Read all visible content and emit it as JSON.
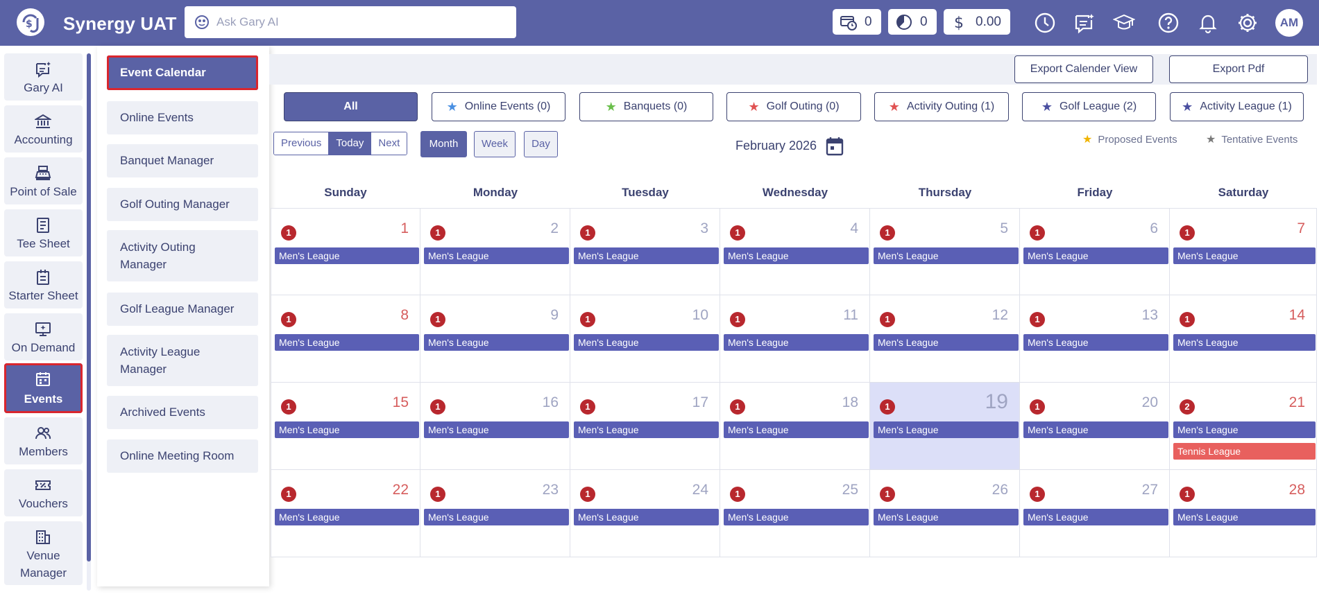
{
  "header": {
    "title": "Synergy UAT",
    "logo_icon": "dollar-logo-icon",
    "search_placeholder": "Ask Gary AI",
    "counters": [
      {
        "icon": "card-clock-icon",
        "value": "0"
      },
      {
        "icon": "pie-chart-icon",
        "value": "0"
      },
      {
        "icon": "dollar-icon",
        "value": "0.00"
      }
    ],
    "icons": [
      "clock-icon",
      "chat-bubble-icon",
      "graduation-icon",
      "help-icon",
      "bell-icon",
      "gear-icon"
    ],
    "avatar": "AM"
  },
  "sidebar": {
    "items": [
      {
        "label": "Gary AI",
        "icon": "gary-ai-icon"
      },
      {
        "label": "Accounting",
        "icon": "bank-icon"
      },
      {
        "label": "Point of Sale",
        "icon": "cash-register-icon"
      },
      {
        "label": "Tee Sheet",
        "icon": "document-icon"
      },
      {
        "label": "Starter Sheet",
        "icon": "clipboard-icon"
      },
      {
        "label": "On Demand",
        "icon": "monitor-icon"
      },
      {
        "label": "Events",
        "icon": "calendar-icon",
        "active": true
      },
      {
        "label": "Members",
        "icon": "users-icon"
      },
      {
        "label": "Vouchers",
        "icon": "ticket-icon"
      },
      {
        "label": "Venue Manager",
        "icon": "building-icon"
      }
    ]
  },
  "submenu": {
    "items": [
      {
        "label": "Event Calendar",
        "active": true
      },
      {
        "label": "Online Events"
      },
      {
        "label": "Banquet Manager"
      },
      {
        "label": "Golf Outing Manager"
      },
      {
        "label": "Activity Outing Manager"
      },
      {
        "label": "Golf League Manager"
      },
      {
        "label": "Activity League Manager"
      },
      {
        "label": "Archived Events"
      },
      {
        "label": "Online Meeting Room"
      }
    ]
  },
  "toolbar": {
    "export_calendar": "Export Calender View",
    "export_pdf": "Export Pdf"
  },
  "filters": [
    {
      "label": "All",
      "star_color": null,
      "active": true
    },
    {
      "label": "Online Events (0)",
      "star_color": "#4a90e2"
    },
    {
      "label": "Banquets (0)",
      "star_color": "#6abf4b"
    },
    {
      "label": "Golf Outing (0)",
      "star_color": "#e05252"
    },
    {
      "label": "Activity Outing (1)",
      "star_color": "#e05252"
    },
    {
      "label": "Golf League (2)",
      "star_color": "#4a4fa0"
    },
    {
      "label": "Activity League (1)",
      "star_color": "#4a4fa0"
    }
  ],
  "calendar_nav": {
    "previous": "Previous",
    "today": "Today",
    "next": "Next",
    "views": [
      "Month",
      "Week",
      "Day"
    ],
    "active_view": "Month",
    "month_label": "February 2026"
  },
  "legend": [
    {
      "label": "Proposed Events",
      "star_color": "#f0b400"
    },
    {
      "label": "Tentative Events",
      "star_color": "#7a7a7a"
    }
  ],
  "calendar": {
    "day_names": [
      "Sunday",
      "Monday",
      "Tuesday",
      "Wednesday",
      "Thursday",
      "Friday",
      "Saturday"
    ],
    "today": 19,
    "weeks": [
      [
        1,
        2,
        3,
        4,
        5,
        6,
        7
      ],
      [
        8,
        9,
        10,
        11,
        12,
        13,
        14
      ],
      [
        15,
        16,
        17,
        18,
        19,
        20,
        21
      ],
      [
        22,
        23,
        24,
        25,
        26,
        27,
        28
      ]
    ],
    "default_event": {
      "label": "Men's League",
      "color": "#5a5fb5"
    },
    "extra_events": {
      "21": [
        {
          "label": "Tennis League",
          "color": "#e8605e"
        }
      ]
    },
    "event_counts": {
      "21": "2"
    },
    "default_count": "1"
  }
}
